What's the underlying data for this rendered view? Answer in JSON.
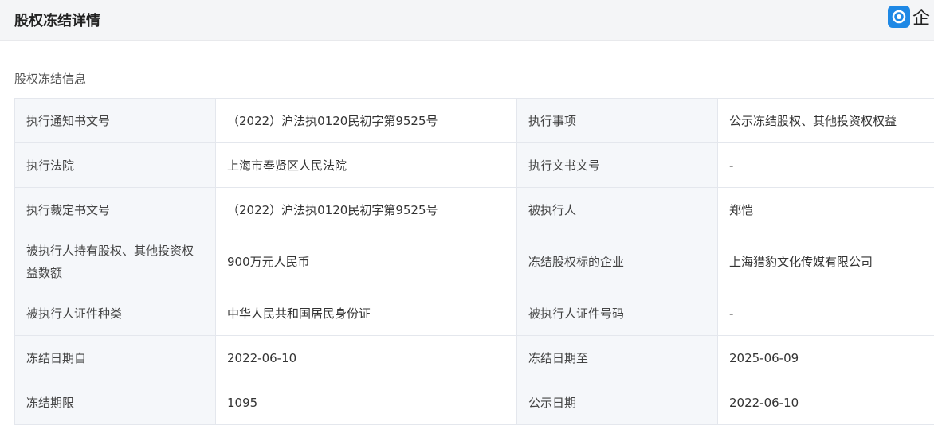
{
  "header": {
    "title": "股权冻结详情",
    "brand_text": "企"
  },
  "section": {
    "title": "股权冻结信息"
  },
  "rows": [
    {
      "l1": "执行通知书文号",
      "v1": "（2022）沪法执0120民初字第9525号",
      "l2": "执行事项",
      "v2": "公示冻结股权、其他投资权权益"
    },
    {
      "l1": "执行法院",
      "v1": "上海市奉贤区人民法院",
      "l2": "执行文书文号",
      "v2": "-"
    },
    {
      "l1": "执行裁定书文号",
      "v1": "（2022）沪法执0120民初字第9525号",
      "l2": "被执行人",
      "v2": "郑恺"
    },
    {
      "l1": "被执行人持有股权、其他投资权益数额",
      "v1": "900万元人民币",
      "l2": "冻结股权标的企业",
      "v2": "上海猎豹文化传媒有限公司"
    },
    {
      "l1": "被执行人证件种类",
      "v1": "中华人民共和国居民身份证",
      "l2": "被执行人证件号码",
      "v2": "-"
    },
    {
      "l1": "冻结日期自",
      "v1": "2022-06-10",
      "l2": "冻结日期至",
      "v2": "2025-06-09"
    },
    {
      "l1": "冻结期限",
      "v1": "1095",
      "l2": "公示日期",
      "v2": "2022-06-10"
    }
  ]
}
